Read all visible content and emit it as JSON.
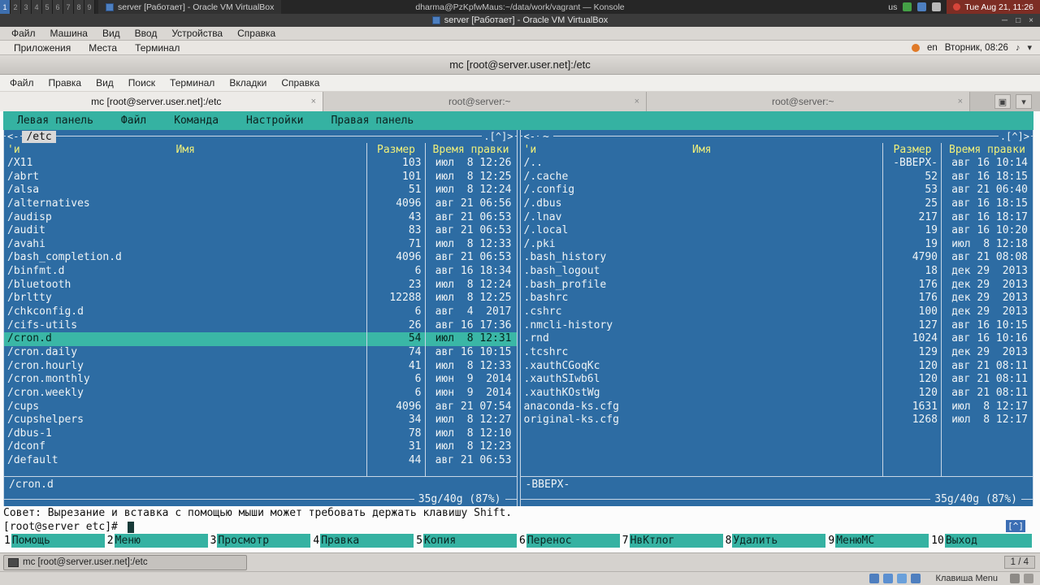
{
  "icons": {
    "close": "×",
    "minimize": "─",
    "maximize": "□",
    "dropdown": "▾",
    "new_tab": "▣",
    "left_arrow": "<-",
    "history_marker": ".[^]>",
    "scroll_badge": "[^]",
    "volume": "♪"
  },
  "host_top_bar": {
    "workspaces": [
      "1",
      "2",
      "3",
      "4",
      "5",
      "6",
      "7",
      "8",
      "9"
    ],
    "active_workspace": "1",
    "task_title": "server [Работает] - Oracle VM VirtualBox",
    "window_title": "dharma@PzKpfwMaus:~/data/work/vagrant — Konsole",
    "keyboard_layout": "us",
    "clock": "Tue Aug 21, 11:26"
  },
  "vbox_window": {
    "title": "server [Работает] - Oracle VM VirtualBox",
    "menu": [
      "Файл",
      "Машина",
      "Вид",
      "Ввод",
      "Устройства",
      "Справка"
    ]
  },
  "guest_panel": {
    "menus": [
      "Приложения",
      "Места",
      "Терминал"
    ],
    "keyboard_layout": "en",
    "clock": "Вторник, 08:26"
  },
  "guest_window_title": "mc [root@server.user.net]:/etc",
  "terminal": {
    "menu": [
      "Файл",
      "Правка",
      "Вид",
      "Поиск",
      "Терминал",
      "Вкладки",
      "Справка"
    ],
    "tabs": [
      {
        "label": "mc [root@server.user.net]:/etc",
        "active": true
      },
      {
        "label": "root@server:~",
        "active": false
      },
      {
        "label": "root@server:~",
        "active": false
      }
    ]
  },
  "mc": {
    "menubar": [
      "Левая панель",
      "Файл",
      "Команда",
      "Настройки",
      "Правая панель"
    ],
    "hint": "Совет: Вырезание и вставка с помощью мыши может требовать держать клавишу Shift.",
    "prompt": "[root@server etc]# ",
    "fn_keys": [
      {
        "num": "1",
        "label": "Помощь"
      },
      {
        "num": "2",
        "label": "Меню"
      },
      {
        "num": "3",
        "label": "Просмотр"
      },
      {
        "num": "4",
        "label": "Правка"
      },
      {
        "num": "5",
        "label": "Копия"
      },
      {
        "num": "6",
        "label": "Перенос"
      },
      {
        "num": "7",
        "label": "НвКтлог"
      },
      {
        "num": "8",
        "label": "Удалить"
      },
      {
        "num": "9",
        "label": "МенюМС"
      },
      {
        "num": "10",
        "label": "Выход"
      }
    ],
    "left_panel": {
      "path": "/etc",
      "sort_marker": "'и",
      "columns": [
        "Имя",
        "Размер",
        "Время правки"
      ],
      "selected_index": 13,
      "status": "/cron.d",
      "size_info": "35g/40g (87%)",
      "rows": [
        [
          "/X11",
          "103",
          "июл  8 12:26"
        ],
        [
          "/abrt",
          "101",
          "июл  8 12:25"
        ],
        [
          "/alsa",
          "51",
          "июл  8 12:24"
        ],
        [
          "/alternatives",
          "4096",
          "авг 21 06:56"
        ],
        [
          "/audisp",
          "43",
          "авг 21 06:53"
        ],
        [
          "/audit",
          "83",
          "авг 21 06:53"
        ],
        [
          "/avahi",
          "71",
          "июл  8 12:33"
        ],
        [
          "/bash_completion.d",
          "4096",
          "авг 21 06:53"
        ],
        [
          "/binfmt.d",
          "6",
          "авг 16 18:34"
        ],
        [
          "/bluetooth",
          "23",
          "июл  8 12:24"
        ],
        [
          "/brltty",
          "12288",
          "июл  8 12:25"
        ],
        [
          "/chkconfig.d",
          "6",
          "авг  4  2017"
        ],
        [
          "/cifs-utils",
          "26",
          "авг 16 17:36"
        ],
        [
          "/cron.d",
          "54",
          "июл  8 12:31"
        ],
        [
          "/cron.daily",
          "74",
          "авг 16 10:15"
        ],
        [
          "/cron.hourly",
          "41",
          "июл  8 12:33"
        ],
        [
          "/cron.monthly",
          "6",
          "июн  9  2014"
        ],
        [
          "/cron.weekly",
          "6",
          "июн  9  2014"
        ],
        [
          "/cups",
          "4096",
          "авг 21 07:54"
        ],
        [
          "/cupshelpers",
          "34",
          "июл  8 12:27"
        ],
        [
          "/dbus-1",
          "78",
          "июл  8 12:10"
        ],
        [
          "/dconf",
          "31",
          "июл  8 12:23"
        ],
        [
          "/default",
          "44",
          "авг 21 06:53"
        ]
      ]
    },
    "right_panel": {
      "path": "~",
      "sort_marker": "'и",
      "columns": [
        "Имя",
        "Размер",
        "Время правки"
      ],
      "selected_index": -1,
      "status": "-ВВЕРХ-",
      "size_info": "35g/40g (87%)",
      "rows": [
        [
          "/..",
          "-ВВЕРХ-",
          "авг 16 10:14"
        ],
        [
          "/.cache",
          "52",
          "авг 16 18:15"
        ],
        [
          "/.config",
          "53",
          "авг 21 06:40"
        ],
        [
          "/.dbus",
          "25",
          "авг 16 18:15"
        ],
        [
          "/.lnav",
          "217",
          "авг 16 18:17"
        ],
        [
          "/.local",
          "19",
          "авг 16 10:20"
        ],
        [
          "/.pki",
          "19",
          "июл  8 12:18"
        ],
        [
          ".bash_history",
          "4790",
          "авг 21 08:08"
        ],
        [
          ".bash_logout",
          "18",
          "дек 29  2013"
        ],
        [
          ".bash_profile",
          "176",
          "дек 29  2013"
        ],
        [
          ".bashrc",
          "176",
          "дек 29  2013"
        ],
        [
          ".cshrc",
          "100",
          "дек 29  2013"
        ],
        [
          ".nmcli-history",
          "127",
          "авг 16 10:15"
        ],
        [
          ".rnd",
          "1024",
          "авг 16 10:16"
        ],
        [
          ".tcshrc",
          "129",
          "дек 29  2013"
        ],
        [
          ".xauthCGoqKc",
          "120",
          "авг 21 08:11"
        ],
        [
          ".xauthSIwb6l",
          "120",
          "авг 21 08:11"
        ],
        [
          ".xauthKOstWg",
          "120",
          "авг 21 08:11"
        ],
        [
          "anaconda-ks.cfg",
          "1631",
          "июл  8 12:17"
        ],
        [
          "original-ks.cfg",
          "1268",
          "июл  8 12:17"
        ]
      ]
    }
  },
  "guest_taskbar": {
    "task_label": "mc [root@server.user.net]:/etc",
    "workspace_indicator": "1 / 4"
  },
  "host_bottom_bar": {
    "label": "Клавиша Menu"
  }
}
